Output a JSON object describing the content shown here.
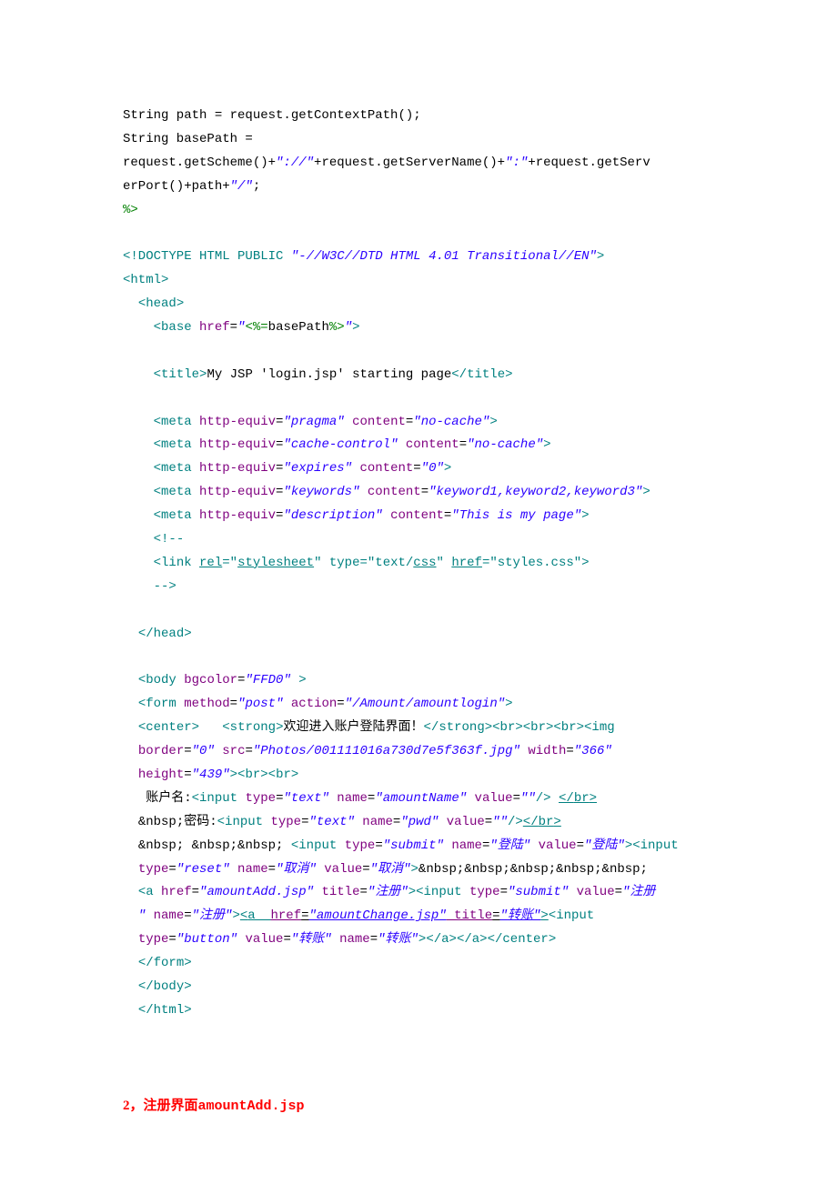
{
  "l1": {
    "a": "String path = request.getContextPath();"
  },
  "l2": {
    "a": "String basePath = "
  },
  "l3": {
    "a": "request.getScheme()+",
    "b": "\"://\"",
    "c": "+request.getServerName()+",
    "d": "\":\"",
    "e": "+request.getServ"
  },
  "l4": {
    "a": "erPort()+path+",
    "b": "\"/\"",
    "c": ";"
  },
  "l5": {
    "a": "%>"
  },
  "l7": {
    "a": "<!DOCTYPE ",
    "b": "HTML ",
    "c": "PUBLIC ",
    "d": "\"-//W3C//DTD HTML 4.01 Transitional//EN\"",
    "e": ">"
  },
  "l8": {
    "a": "<",
    "b": "html",
    "c": ">"
  },
  "l9": {
    "a": "  ",
    "b": "<",
    "c": "head",
    "d": ">"
  },
  "l10": {
    "a": "    ",
    "b": "<",
    "c": "base ",
    "d": "href",
    "e": "=",
    "f": "\"",
    "g": "<%=",
    "h": "basePath",
    "i": "%>",
    "j": "\"",
    "k": ">"
  },
  "l12": {
    "a": "    ",
    "b": "<",
    "c": "title",
    "d": ">",
    "e": "My JSP 'login.jsp' starting page",
    "f": "</",
    "g": "title",
    "h": ">"
  },
  "l14": {
    "a": "    ",
    "b": "<",
    "c": "meta ",
    "d": "http-equiv",
    "e": "=",
    "f": "\"pragma\"",
    "g": " content",
    "h": "=",
    "i": "\"no-cache\"",
    "j": ">"
  },
  "l15": {
    "a": "    ",
    "b": "<",
    "c": "meta ",
    "d": "http-equiv",
    "e": "=",
    "f": "\"cache-control\"",
    "g": " content",
    "h": "=",
    "i": "\"no-cache\"",
    "j": ">"
  },
  "l16": {
    "a": "    ",
    "b": "<",
    "c": "meta ",
    "d": "http-equiv",
    "e": "=",
    "f": "\"expires\"",
    "g": " content",
    "h": "=",
    "i": "\"0\"",
    "j": ">"
  },
  "l17": {
    "a": "    ",
    "b": "<",
    "c": "meta ",
    "d": "http-equiv",
    "e": "=",
    "f": "\"keywords\"",
    "g": " content",
    "h": "=",
    "i": "\"keyword1,keyword2,keyword3\"",
    "j": ">"
  },
  "l18": {
    "a": "    ",
    "b": "<",
    "c": "meta ",
    "d": "http-equiv",
    "e": "=",
    "f": "\"description\"",
    "g": " content",
    "h": "=",
    "i": "\"This is my page\"",
    "j": ">"
  },
  "l19": {
    "a": "    ",
    "b": "<!--"
  },
  "l20": {
    "a": "    <link ",
    "b": "rel",
    "c": "=\"",
    "d": "stylesheet",
    "e": "\" type=\"text/",
    "f": "css",
    "g": "\" ",
    "h": "href",
    "i": "=\"styles.css\">"
  },
  "l21": {
    "a": "    -->"
  },
  "l23": {
    "a": "  ",
    "b": "</",
    "c": "head",
    "d": ">"
  },
  "l25": {
    "a": "  ",
    "b": "<",
    "c": "body ",
    "d": "bgcolor",
    "e": "=",
    "f": "\"FFD0\"",
    "g": " >"
  },
  "l26": {
    "a": "  ",
    "b": "<",
    "c": "form ",
    "d": "method",
    "e": "=",
    "f": "\"post\"",
    "g": " action",
    "h": "=",
    "i": "\"/Amount/amountlogin\"",
    "j": ">"
  },
  "l27": {
    "a": "  ",
    "b": "<",
    "c": "center",
    "d": ">",
    "e": "   ",
    "f": "<",
    "g": "strong",
    "h": ">",
    "i": "欢迎进入账户登陆界面！",
    "j": "</",
    "k": "strong",
    "l": "><",
    "m": "br",
    "n": "><",
    "o": "br",
    "p": "><",
    "q": "br",
    "r": "><",
    "s": "img"
  },
  "l28": {
    "a": "  ",
    "b": "border",
    "c": "=",
    "d": "\"0\"",
    "e": " src",
    "f": "=",
    "g": "\"Photos/001111016a730d7e5f363f.jpg\"",
    "h": " width",
    "i": "=",
    "j": "\"366\""
  },
  "l29": {
    "a": "  ",
    "b": "height",
    "c": "=",
    "d": "\"439\"",
    "e": "><",
    "f": "br",
    "g": "><",
    "h": "br",
    "i": ">"
  },
  "l30": {
    "a": "   账户名:",
    "b": "<",
    "c": "input ",
    "d": "type",
    "e": "=",
    "f": "\"text\"",
    "g": " name",
    "h": "=",
    "i": "\"amountName\"",
    "j": " value",
    "k": "=",
    "l": "\"\"",
    "m": "/>",
    "n": " ",
    "o": "</",
    "p": "br",
    "q": ">"
  },
  "l31": {
    "a": "  ",
    "b": "&nbsp;",
    "c": "密码:",
    "d": "<",
    "e": "input ",
    "f": "type",
    "g": "=",
    "h": "\"text\"",
    "i": " name",
    "j": "=",
    "k": "\"pwd\"",
    "l": " value",
    "m": "=",
    "n": "\"\"",
    "o": "/>",
    "p": "</",
    "q": "br",
    "r": ">"
  },
  "l32": {
    "a": "  ",
    "b": "&nbsp;",
    "c": " ",
    "d": "&nbsp;&nbsp;",
    "e": " ",
    "f": "<",
    "g": "input ",
    "h": "type",
    "i": "=",
    "j": "\"submit\"",
    "k": " name",
    "l": "=",
    "m": "\"",
    "n": "登陆",
    "o": "\"",
    "p": " value",
    "q": "=",
    "r": "\"",
    "s": "登陆",
    "t": "\"",
    "u": "><",
    "v": "input"
  },
  "l33": {
    "a": "  ",
    "b": "type",
    "c": "=",
    "d": "\"reset\"",
    "e": " name",
    "f": "=",
    "g": "\"",
    "h": "取消",
    "i": "\"",
    "j": " value",
    "k": "=",
    "l": "\"",
    "m": "取消",
    "n": "\"",
    "o": ">",
    "p": "&nbsp;&nbsp;&nbsp;&nbsp;&nbsp;"
  },
  "l34": {
    "a": "  ",
    "b": "<",
    "c": "a ",
    "d": "href",
    "e": "=",
    "f": "\"amountAdd.jsp\"",
    "g": " title",
    "h": "=",
    "i": "\"",
    "j": "注册",
    "k": "\"",
    "l": "><",
    "m": "input ",
    "n": "type",
    "o": "=",
    "p": "\"submit\"",
    "q": " value",
    "r": "=",
    "s": "\"",
    "t": "注册"
  },
  "l35": {
    "a": "  ",
    "b": "\"",
    "c": " name",
    "d": "=",
    "e": "\"",
    "f": "注册",
    "g": "\"",
    "h": ">",
    "i": "<",
    "j": "a  ",
    "k": "href",
    "l": "=",
    "m": "\"amountChange.jsp\"",
    "n": " title",
    "o": "=",
    "p": "\"",
    "q": "转账",
    "r": "\"",
    "s": ">",
    "t": "<",
    "u": "input"
  },
  "l36": {
    "a": "  ",
    "b": "type",
    "c": "=",
    "d": "\"button\"",
    "e": " value",
    "f": "=",
    "g": "\"",
    "h": "转账",
    "i": "\"",
    "j": " name",
    "k": "=",
    "l": "\"",
    "m": "转账",
    "n": "\"",
    "o": "></",
    "p": "a",
    "q": "></",
    "r": "a",
    "s": "></",
    "t": "center",
    "u": ">"
  },
  "l37": {
    "a": "  ",
    "b": "</",
    "c": "form",
    "d": ">"
  },
  "l38": {
    "a": "  ",
    "b": "</",
    "c": "body",
    "d": ">"
  },
  "l39": {
    "a": "  ",
    "b": "</",
    "c": "html",
    "d": ">"
  },
  "heading": {
    "a": "2，注册界面",
    "b": "amountAdd.jsp"
  }
}
